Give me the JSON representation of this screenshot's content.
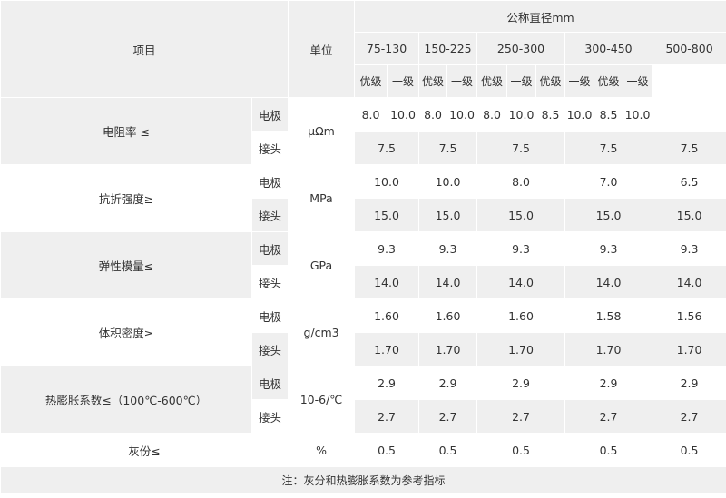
{
  "header": {
    "item": "项目",
    "unit": "单位",
    "diameter": "公称直径mm",
    "ranges": [
      "75-130",
      "150-225",
      "250-300",
      "300-450",
      "500-800"
    ],
    "grades": [
      "优级",
      "一级",
      "优级",
      "一级",
      "优级",
      "一级",
      "优级",
      "一级",
      "优级",
      "一级"
    ]
  },
  "rows": [
    {
      "label": "电阻率 ≤",
      "unit": "μΩm",
      "electrode_label": "电极",
      "joint_label": "接头",
      "electrode": [
        "8.0",
        "10.0",
        "8.0",
        "10.0",
        "8.0",
        "10.0",
        "8.5",
        "10.0",
        "8.5",
        "10.0"
      ],
      "joint": [
        "7.5",
        "7.5",
        "7.5",
        "7.5",
        "7.5"
      ]
    },
    {
      "label": "抗折强度≥",
      "unit": "MPa",
      "electrode_label": "电极",
      "joint_label": "接头",
      "electrode": [
        "10.0",
        "10.0",
        "8.0",
        "7.0",
        "6.5"
      ],
      "joint": [
        "15.0",
        "15.0",
        "15.0",
        "15.0",
        "15.0"
      ]
    },
    {
      "label": "弹性模量≤",
      "unit": "GPa",
      "electrode_label": "电极",
      "joint_label": "接头",
      "electrode": [
        "9.3",
        "9.3",
        "9.3",
        "9.3",
        "9.3"
      ],
      "joint": [
        "14.0",
        "14.0",
        "14.0",
        "14.0",
        "14.0"
      ]
    },
    {
      "label": "体积密度≥",
      "unit": "g/cm3",
      "electrode_label": "电极",
      "joint_label": "接头",
      "electrode": [
        "1.60",
        "1.60",
        "1.60",
        "1.58",
        "1.56"
      ],
      "joint": [
        "1.70",
        "1.70",
        "1.70",
        "1.70",
        "1.70"
      ]
    },
    {
      "label": "热膨胀系数≤（100℃-600℃）",
      "unit": "10-6/℃",
      "electrode_label": "电极",
      "joint_label": "接头",
      "electrode": [
        "2.9",
        "2.9",
        "2.9",
        "2.9",
        "2.9"
      ],
      "joint": [
        "2.7",
        "2.7",
        "2.7",
        "2.7",
        "2.7"
      ]
    }
  ],
  "ash": {
    "label": "灰份≤",
    "unit": "%",
    "values": [
      "0.5",
      "0.5",
      "0.5",
      "0.5",
      "0.5"
    ]
  },
  "note": "注：灰分和热膨胀系数为参考指标"
}
